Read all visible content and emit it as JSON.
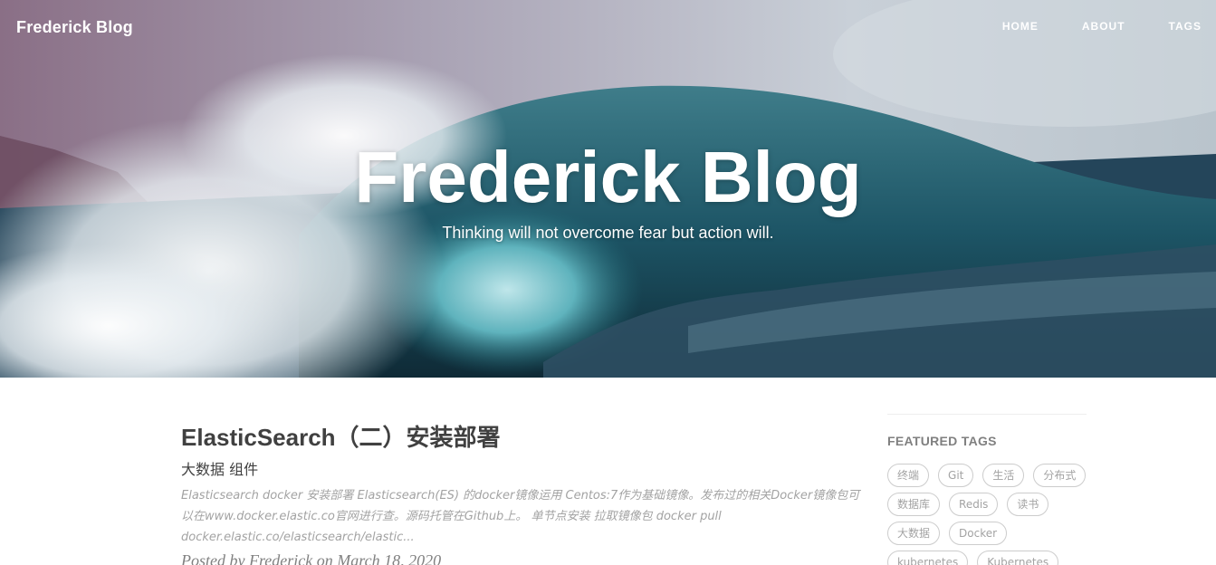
{
  "brand": "Frederick Blog",
  "nav": {
    "home": "HOME",
    "about": "ABOUT",
    "tags": "TAGS"
  },
  "hero": {
    "title": "Frederick Blog",
    "subtitle": "Thinking will not overcome fear but action will."
  },
  "post": {
    "title": "ElasticSearch（二）安装部署",
    "subtitle": "大数据 组件",
    "excerpt": "Elasticsearch docker 安装部署 Elasticsearch(ES) 的docker镜像运用 Centos:7作为基础镜像。发布过的相关Docker镜像包可以在www.docker.elastic.co官网进行查。源码托管在Github上。 单节点安装 拉取镜像包 docker pull docker.elastic.co/elasticsearch/elastic...",
    "meta": "Posted by Frederick on March 18, 2020"
  },
  "sidebar": {
    "heading": "FEATURED TAGS",
    "tags": [
      "终端",
      "Git",
      "生活",
      "分布式",
      "数据库",
      "Redis",
      "读书",
      "大数据",
      "Docker",
      "kubernetes",
      "Kubernetes"
    ]
  }
}
